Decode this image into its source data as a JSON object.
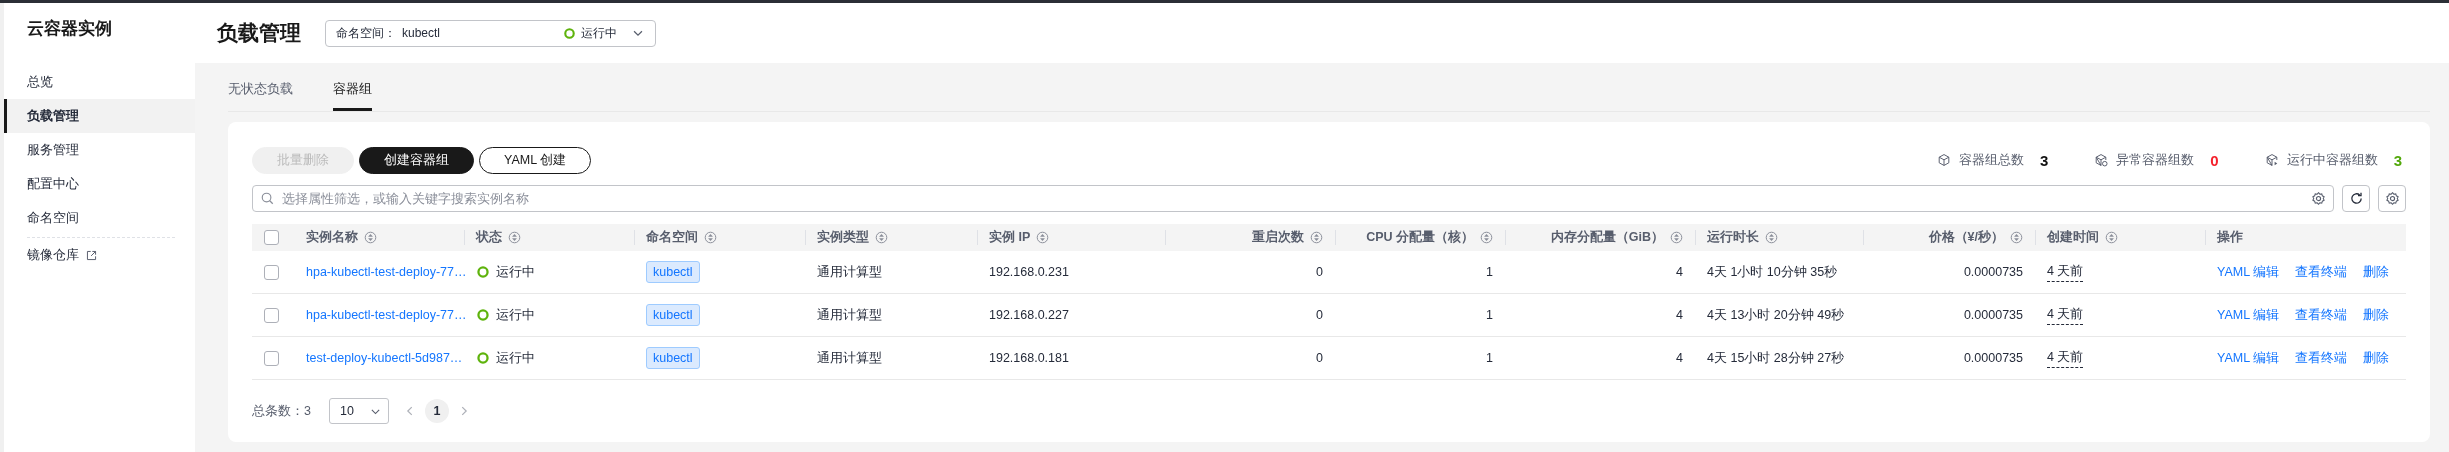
{
  "sidebar": {
    "title": "云容器实例",
    "items": [
      {
        "label": "总览",
        "selected": false,
        "external": false
      },
      {
        "label": "负载管理",
        "selected": true,
        "external": false
      },
      {
        "label": "服务管理",
        "selected": false,
        "external": false
      },
      {
        "label": "配置中心",
        "selected": false,
        "external": false
      },
      {
        "label": "命名空间",
        "selected": false,
        "external": false
      },
      {
        "label": "镜像仓库",
        "selected": false,
        "external": true
      }
    ]
  },
  "header": {
    "title": "负载管理",
    "namespace_select": {
      "label": "命名空间：",
      "value": "kubectl",
      "status": "运行中"
    }
  },
  "tabs": [
    {
      "label": "无状态负载",
      "selected": false
    },
    {
      "label": "容器组",
      "selected": true
    }
  ],
  "toolbar": {
    "buttons": [
      {
        "label": "批量删除",
        "kind": "secondary",
        "disabled": true
      },
      {
        "label": "创建容器组",
        "kind": "primary",
        "disabled": false
      },
      {
        "label": "YAML 创建",
        "kind": "outline",
        "disabled": false
      }
    ]
  },
  "stats": [
    {
      "label": "容器组总数",
      "value": "3",
      "color": "#111111"
    },
    {
      "label": "异常容器组数",
      "value": "0",
      "color": "#f5222d"
    },
    {
      "label": "运行中容器组数",
      "value": "3",
      "color": "#52a80a"
    }
  ],
  "search": {
    "placeholder": "选择属性筛选，或输入关键字搜索实例名称"
  },
  "table": {
    "all_checked": false,
    "columns": [
      {
        "label": "实例名称",
        "sortable": true
      },
      {
        "label": "状态",
        "sortable": true
      },
      {
        "label": "命名空间",
        "sortable": true
      },
      {
        "label": "实例类型",
        "sortable": true
      },
      {
        "label": "实例 IP",
        "sortable": true
      },
      {
        "label": "重启次数",
        "sortable": true
      },
      {
        "label": "CPU 分配量（核）",
        "sortable": true
      },
      {
        "label": "内存分配量（GiB）",
        "sortable": true
      },
      {
        "label": "运行时长",
        "sortable": true
      },
      {
        "label": "价格（¥/秒）",
        "sortable": true
      },
      {
        "label": "创建时间",
        "sortable": true
      },
      {
        "label": "操作",
        "sortable": false
      }
    ],
    "rows": [
      {
        "checked": false,
        "name": "hpa-kubectl-test-deploy-77…",
        "status": "运行中",
        "namespace": "kubectl",
        "type": "通用计算型",
        "ip": "192.168.0.231",
        "restarts": "0",
        "cpu": "1",
        "memory": "4",
        "uptime": "4天 1小时 10分钟 35秒",
        "price": "0.0000735",
        "created": "4 天前",
        "actions": [
          "YAML 编辑",
          "查看终端",
          "删除"
        ]
      },
      {
        "checked": false,
        "name": "hpa-kubectl-test-deploy-77…",
        "status": "运行中",
        "namespace": "kubectl",
        "type": "通用计算型",
        "ip": "192.168.0.227",
        "restarts": "0",
        "cpu": "1",
        "memory": "4",
        "uptime": "4天 13小时 20分钟 49秒",
        "price": "0.0000735",
        "created": "4 天前",
        "actions": [
          "YAML 编辑",
          "查看终端",
          "删除"
        ]
      },
      {
        "checked": false,
        "name": "test-deploy-kubectl-5d987…",
        "status": "运行中",
        "namespace": "kubectl",
        "type": "通用计算型",
        "ip": "192.168.0.181",
        "restarts": "0",
        "cpu": "1",
        "memory": "4",
        "uptime": "4天 15小时 28分钟 27秒",
        "price": "0.0000735",
        "created": "4 天前",
        "actions": [
          "YAML 编辑",
          "查看终端",
          "删除"
        ]
      }
    ]
  },
  "pagination": {
    "total_label": "总条数：",
    "total": "3",
    "page_size": "10",
    "pages": [
      {
        "label": "1",
        "selected": true
      }
    ]
  }
}
